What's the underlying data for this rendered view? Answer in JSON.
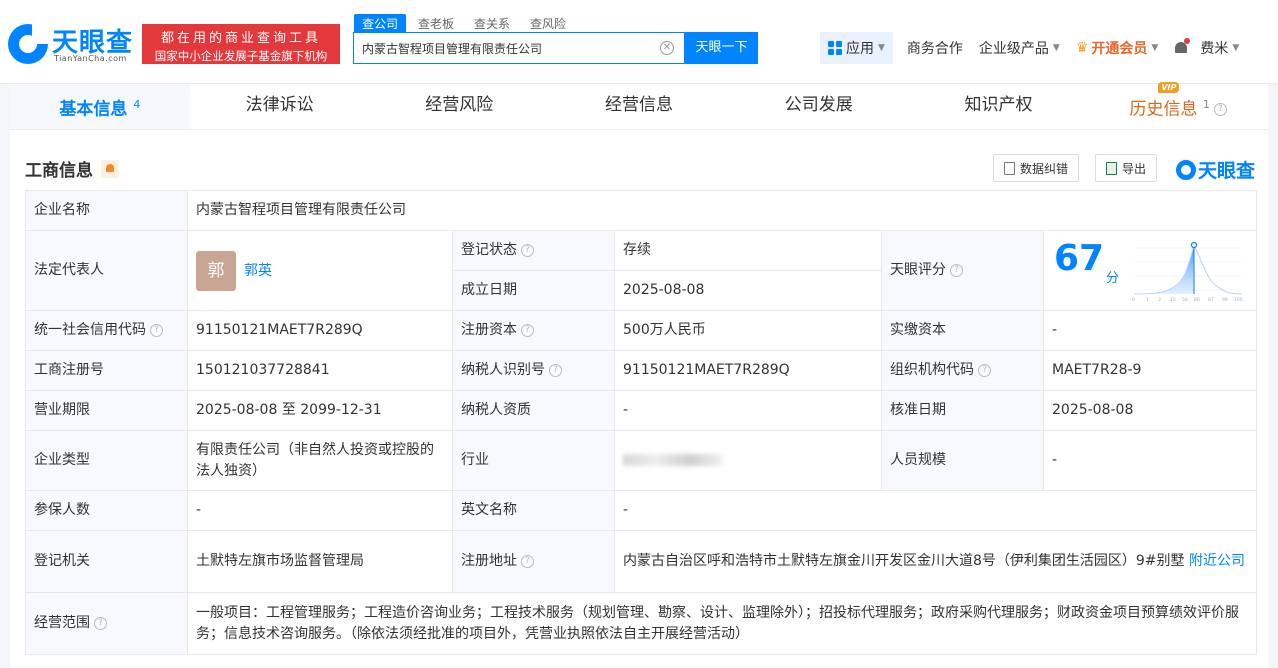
{
  "header": {
    "logo_text": "天眼查",
    "logo_sub": "TianYanCha.com",
    "slogan_line1": "都在用的商业查询工具",
    "slogan_line2": "国家中小企业发展子基金旗下机构",
    "search_tabs": [
      "查公司",
      "查老板",
      "查关系",
      "查风险"
    ],
    "search_value": "内蒙古智程项目管理有限责任公司",
    "search_button": "天眼一下",
    "nav": {
      "app": "应用",
      "business": "商务合作",
      "enterprise": "企业级产品",
      "vip": "开通会员",
      "user": "费米"
    }
  },
  "tabs": [
    {
      "label": "基本信息",
      "count": "4"
    },
    {
      "label": "法律诉讼",
      "count": ""
    },
    {
      "label": "经营风险",
      "count": ""
    },
    {
      "label": "经营信息",
      "count": ""
    },
    {
      "label": "公司发展",
      "count": ""
    },
    {
      "label": "知识产权",
      "count": ""
    },
    {
      "label": "历史信息",
      "count": "1",
      "badge": "VIP"
    }
  ],
  "section": {
    "title": "工商信息",
    "correct_btn": "数据纠错",
    "export_btn": "导出",
    "brand": "天眼查"
  },
  "info": {
    "company_name_label": "企业名称",
    "company_name": "内蒙古智程项目管理有限责任公司",
    "legal_rep_label": "法定代表人",
    "legal_rep_avatar": "郭",
    "legal_rep": "郭英",
    "reg_status_label": "登记状态",
    "reg_status": "存续",
    "found_date_label": "成立日期",
    "found_date": "2025-08-08",
    "score_label": "天眼评分",
    "score": "67",
    "score_unit": "分",
    "credit_code_label": "统一社会信用代码",
    "credit_code": "91150121MAET7R289Q",
    "reg_capital_label": "注册资本",
    "reg_capital": "500万人民币",
    "paid_capital_label": "实缴资本",
    "paid_capital": "-",
    "reg_no_label": "工商注册号",
    "reg_no": "150121037728841",
    "taxpayer_id_label": "纳税人识别号",
    "taxpayer_id": "91150121MAET7R289Q",
    "org_code_label": "组织机构代码",
    "org_code": "MAET7R28-9",
    "term_label": "营业期限",
    "term": "2025-08-08 至 2099-12-31",
    "tax_quality_label": "纳税人资质",
    "tax_quality": "-",
    "approve_date_label": "核准日期",
    "approve_date": "2025-08-08",
    "company_type_label": "企业类型",
    "company_type": "有限责任公司（非自然人投资或控股的法人独资）",
    "industry_label": "行业",
    "staff_size_label": "人员规模",
    "staff_size": "-",
    "insured_label": "参保人数",
    "insured": "-",
    "english_name_label": "英文名称",
    "english_name": "-",
    "authority_label": "登记机关",
    "authority": "土默特左旗市场监督管理局",
    "address_label": "注册地址",
    "address": "内蒙古自治区呼和浩特市土默特左旗金川开发区金川大道8号（伊利集团生活园区）9#别墅",
    "nearby_link": "附近公司",
    "scope_label": "经营范围",
    "scope": "一般项目：工程管理服务；工程造价咨询业务；工程技术服务（规划管理、勘察、设计、监理除外）；招投标代理服务；政府采购代理服务；财政资金项目预算绩效评价服务；信息技术咨询服务。（除依法须经批准的项目外，凭营业执照依法自主开展经营活动）"
  },
  "colors": {
    "accent": "#0084ff",
    "status_ok": "#1a9c4e",
    "slogan_bg": "#e4393c",
    "vip": "#e8672b"
  }
}
